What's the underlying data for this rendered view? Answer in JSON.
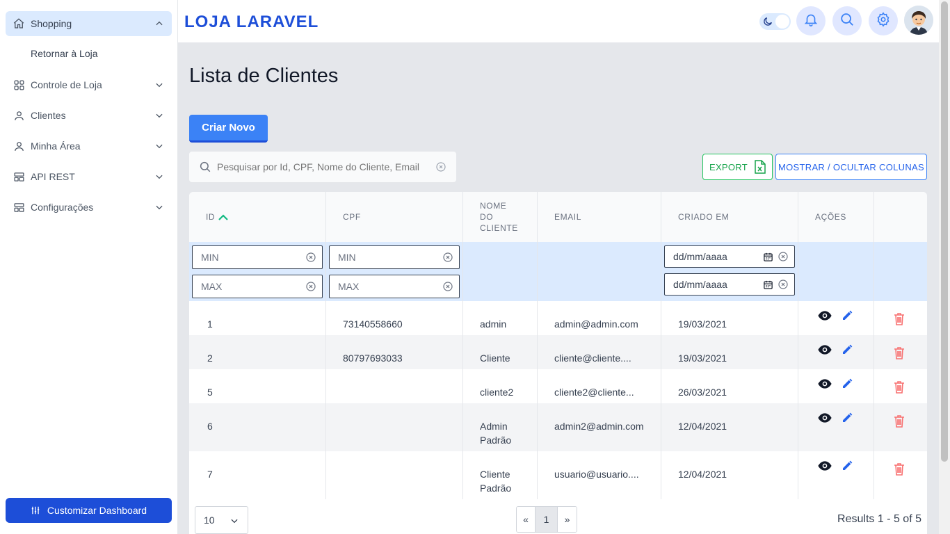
{
  "sidebar": {
    "items": [
      {
        "label": "Shopping",
        "icon": "home-icon"
      },
      {
        "label": "Controle de Loja",
        "icon": "grid-icon"
      },
      {
        "label": "Clientes",
        "icon": "user-icon"
      },
      {
        "label": "Minha Área",
        "icon": "user-icon"
      },
      {
        "label": "API REST",
        "icon": "layout-icon"
      },
      {
        "label": "Configurações",
        "icon": "layout-icon"
      }
    ],
    "sub_item": "Retornar à Loja",
    "customize_label": "Customizar Dashboard"
  },
  "header": {
    "brand": "LOJA LARAVEL"
  },
  "page": {
    "title": "Lista de Clientes",
    "create_label": "Criar Novo",
    "search_placeholder": "Pesquisar por Id, CPF, Nome do Cliente, Email",
    "export_label": "EXPORT",
    "columns_label": "MOSTRAR / OCULTAR COLUNAS"
  },
  "table": {
    "headers": {
      "id": "ID",
      "cpf": "CPF",
      "name_1": "NOME",
      "name_2": "DO",
      "name_3": "CLIENTE",
      "email": "EMAIL",
      "created": "CRIADO EM",
      "actions": "AÇÕES"
    },
    "filters": {
      "min": "MIN",
      "max": "MAX",
      "date_placeholder": "dd/mm/aaaa"
    },
    "rows": [
      {
        "id": "1",
        "cpf": "73140558660",
        "name1": "admin",
        "name2": "",
        "email": "admin@admin.com",
        "created": "19/03/2021"
      },
      {
        "id": "2",
        "cpf": "80797693033",
        "name1": "Cliente",
        "name2": "",
        "email": "cliente@cliente....",
        "created": "19/03/2021"
      },
      {
        "id": "5",
        "cpf": "",
        "name1": "cliente2",
        "name2": "",
        "email": "cliente2@cliente...",
        "created": "26/03/2021"
      },
      {
        "id": "6",
        "cpf": "",
        "name1": "Admin",
        "name2": "Padrão",
        "email": "admin2@admin.com",
        "created": "12/04/2021"
      },
      {
        "id": "7",
        "cpf": "",
        "name1": "Cliente",
        "name2": "Padrão",
        "email": "usuario@usuario....",
        "created": "12/04/2021"
      }
    ]
  },
  "footer": {
    "per_page": "10",
    "prev": "«",
    "page": "1",
    "next": "»",
    "results": "Results 1 - 5 of 5"
  },
  "colors": {
    "primary": "#3b82f6",
    "brand": "#1d4ed8",
    "success": "#16a34a",
    "danger": "#f87171"
  }
}
